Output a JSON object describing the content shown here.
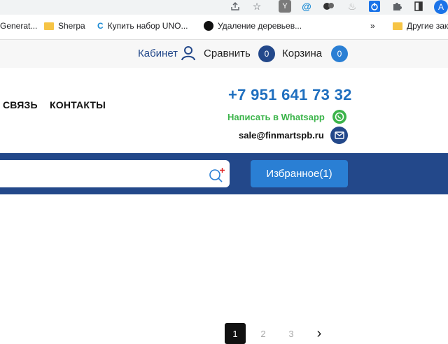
{
  "bookmarks": {
    "items": [
      {
        "label": "Generat..."
      },
      {
        "label": "Sherpa"
      },
      {
        "label": "Купить набор UNO..."
      },
      {
        "label": "Удаление деревьев..."
      },
      {
        "label": "Другие закл"
      }
    ],
    "overflow": "»"
  },
  "account_avatar": "A",
  "topbar": {
    "cabinet": "Кабинет",
    "compare": "Сравнить",
    "compare_count": "0",
    "cart": "Корзина",
    "cart_count": "0"
  },
  "header": {
    "nav": [
      "СВЯЗЬ",
      "КОНТАКТЫ"
    ],
    "phone": "+7 951 641 73 32",
    "whatsapp": "Написать в Whatsapp",
    "email": "sale@finmartspb.ru"
  },
  "bluebar": {
    "favorites": "Избранное(1)"
  },
  "pagination": {
    "pages": [
      "1",
      "2",
      "3"
    ],
    "next": "›"
  },
  "colors": {
    "brand_blue": "#23488a",
    "accent_blue": "#2a7fd4",
    "whatsapp_green": "#3bb44a"
  }
}
